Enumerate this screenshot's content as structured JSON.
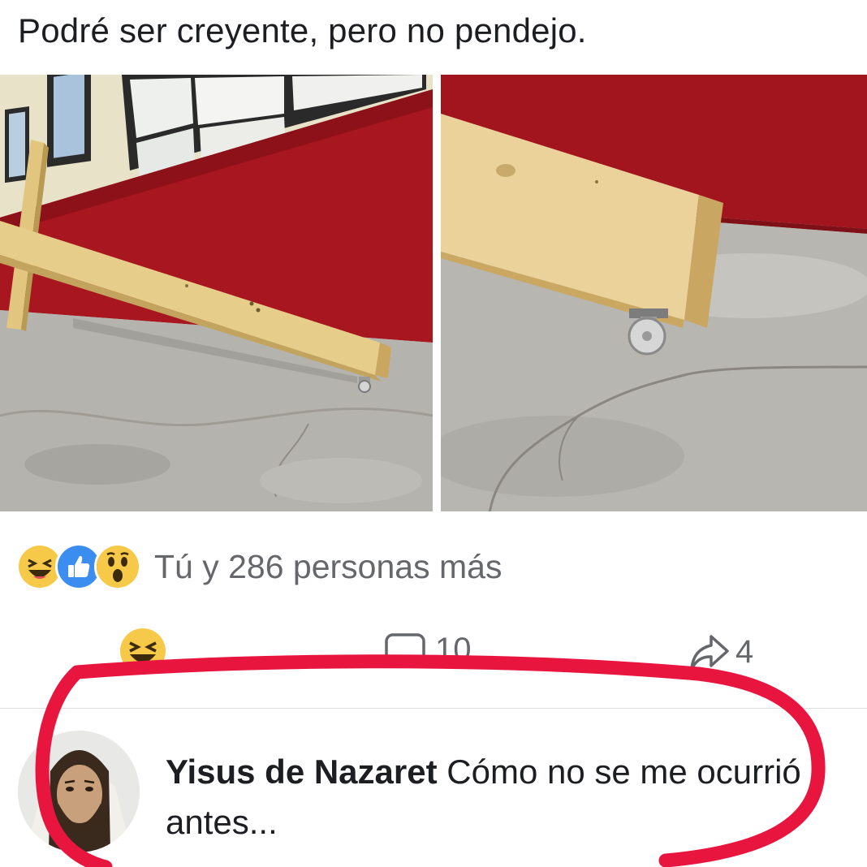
{
  "post": {
    "text": "Podré ser creyente, pero no pendejo."
  },
  "reactions": {
    "icons": [
      "laugh-reaction-icon",
      "like-reaction-icon",
      "wow-reaction-icon"
    ],
    "summary": "Tú y 286 personas más"
  },
  "actions": {
    "comments_count": "10",
    "shares_count": "4"
  },
  "comment": {
    "author": "Yisus de Nazaret",
    "text": "Cómo no se me ocurrió antes..."
  },
  "colors": {
    "annotation_circle": "#e8163f",
    "like_blue": "#3b8ef0",
    "emoji_yellow": "#f7c948",
    "wall_red": "#a81620"
  }
}
